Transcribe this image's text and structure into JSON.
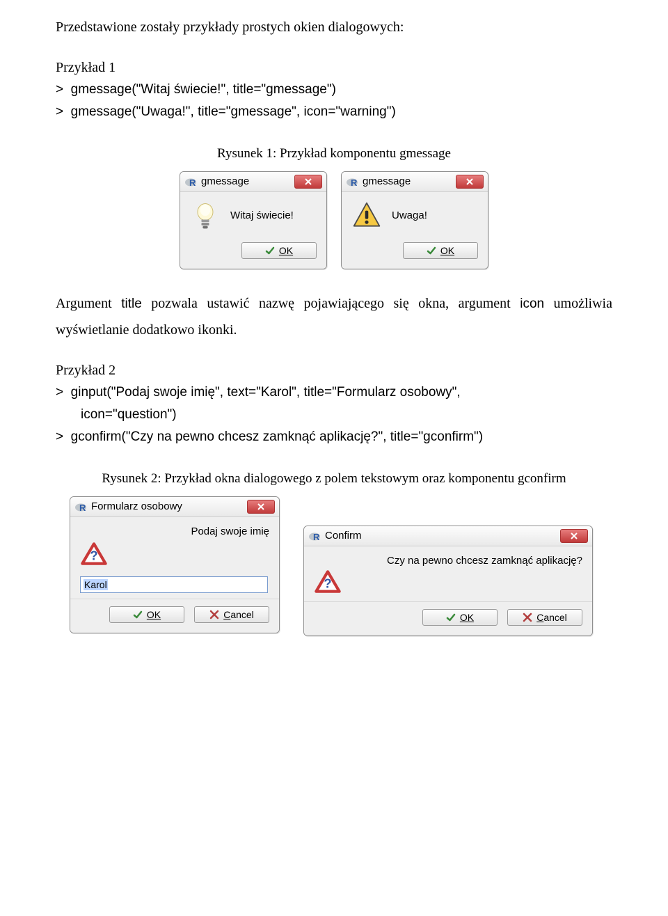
{
  "intro": "Przedstawione zostały przykłady prostych okien dialogowych:",
  "example1_label": "Przykład 1",
  "code1_line1": ">  gmessage(\"Witaj świecie!\", title=\"gmessage\")",
  "code1_line2": ">  gmessage(\"Uwaga!\", title=\"gmessage\", icon=\"warning\")",
  "caption1": "Rysunek 1: Przykład komponentu gmessage",
  "dialog1": {
    "title": "gmessage",
    "message": "Witaj świecie!",
    "ok": "OK"
  },
  "dialog2": {
    "title": "gmessage",
    "message": "Uwaga!",
    "ok": "OK"
  },
  "para2_pre": "Argument ",
  "para2_code1": "title",
  "para2_mid": " pozwala ustawić nazwę pojawiającego się okna, argument ",
  "para2_code2": "icon",
  "para2_post": " umożliwia wyświetlanie dodatkowo ikonki.",
  "example2_label": "Przykład 2",
  "code2_line1": ">  ginput(\"Podaj swoje imię\", text=\"Karol\", title=\"Formularz osobowy\",",
  "code2_line2": "icon=\"question\")",
  "code2_line3": ">  gconfirm(\"Czy na pewno chcesz zamknąć aplikację?\", title=\"gconfirm\")",
  "caption2": "Rysunek 2: Przykład okna dialogowego z polem tekstowym oraz komponentu gconfirm",
  "dialog3": {
    "title": "Formularz osobowy",
    "message": "Podaj swoje imię",
    "input_value": "Karol",
    "ok": "OK",
    "cancel": "Cancel"
  },
  "dialog4": {
    "title": "Confirm",
    "message": "Czy na pewno chcesz zamknąć aplikację?",
    "ok": "OK",
    "cancel": "Cancel"
  }
}
